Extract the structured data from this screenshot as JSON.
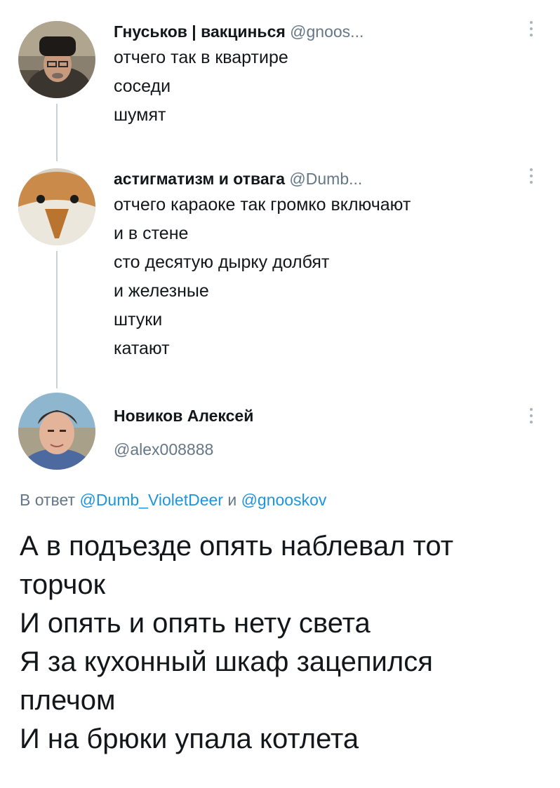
{
  "tweets": [
    {
      "name": "Гнуськов | вакцинься",
      "handle": "@gnoos...",
      "lines": [
        "отчего так в квартире",
        "соседи",
        "шумят"
      ]
    },
    {
      "name": "астигматизм и отвага",
      "handle": "@Dumb...",
      "lines": [
        "отчего караоке так громко включают",
        "и в стене",
        "сто десятую дырку долбят",
        "и железные",
        "штуки",
        "катают"
      ]
    }
  ],
  "main_tweet": {
    "name": "Новиков Алексей",
    "handle": "@alex008888",
    "reply_prefix": "В ответ",
    "reply_mention_1": "@Dumb_VioletDeer",
    "reply_and": "и",
    "reply_mention_2": "@gnooskov",
    "lines": [
      "А в подъезде опять наблевал тот",
      "торчок",
      "И опять и опять нету света",
      "Я за кухонный шкаф зацепился",
      "плечом",
      "И на брюки упала котлета"
    ]
  },
  "icons": {
    "more": "more-vertical-icon"
  },
  "colors": {
    "text": "#14171a",
    "secondary": "#657786",
    "link": "#1b95e0",
    "thread_line": "#c9d1d8"
  }
}
